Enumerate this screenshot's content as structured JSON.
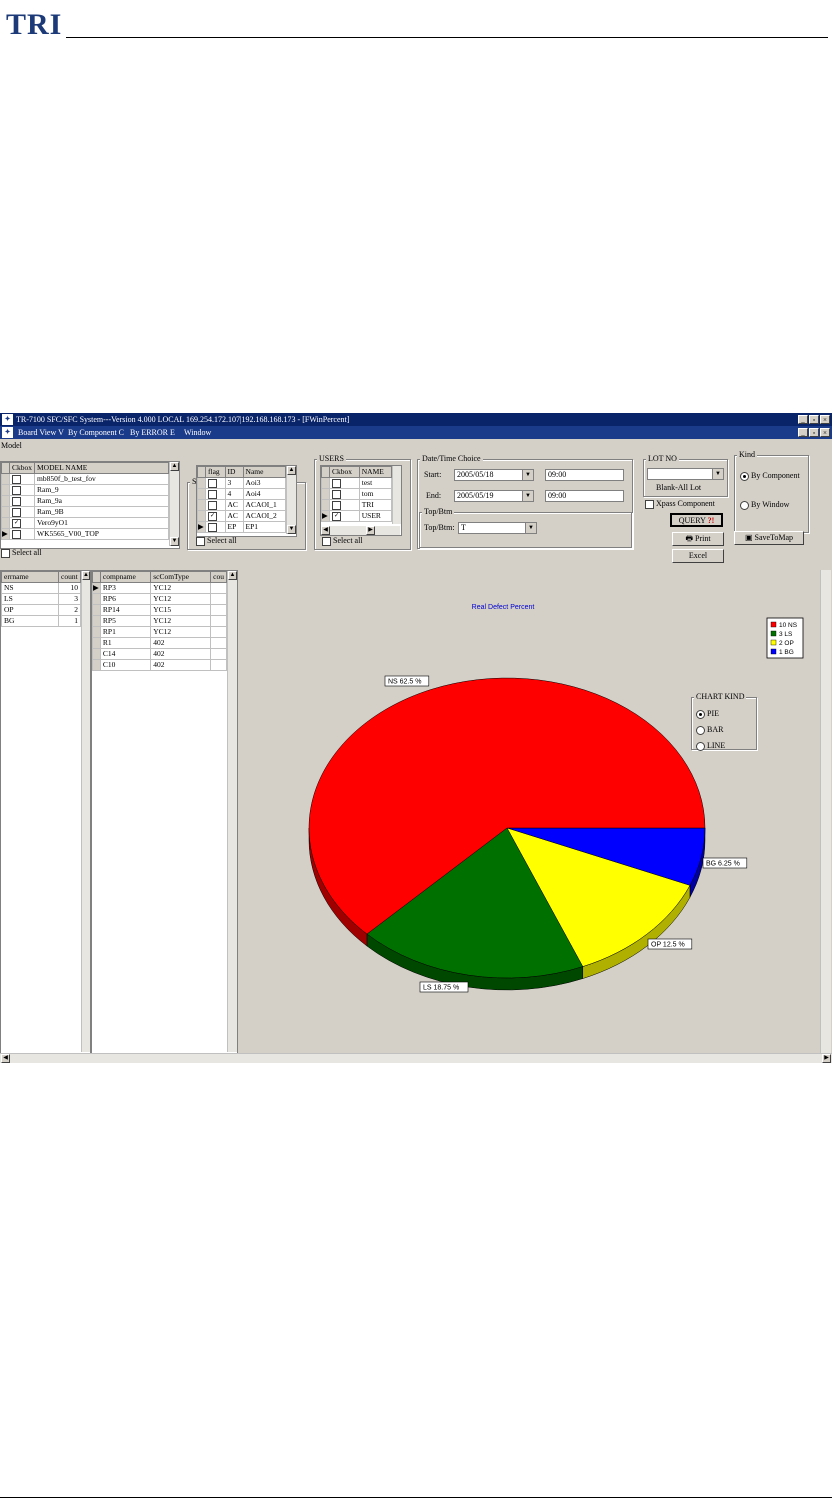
{
  "doc": {
    "logo": "TRI"
  },
  "window": {
    "title": "TR-7100 SFC/SFC System---Version 4.000 LOCAL 169.254.172.107|192.168.168.173 - [FWinPercent]",
    "menu": [
      "Board View V",
      "By Component C",
      "By ERROR E",
      "Window"
    ],
    "btn_min": "_",
    "btn_max": "▫",
    "btn_close": "×"
  },
  "model": {
    "title": "Model",
    "headers": [
      "Ckbox",
      "MODEL NAME"
    ],
    "rows": [
      {
        "name": "mb850f_b_test_fov",
        "checked": false,
        "current": false
      },
      {
        "name": "Ram_9",
        "checked": false,
        "current": false
      },
      {
        "name": "Ram_9a",
        "checked": false,
        "current": false
      },
      {
        "name": "Ram_9B",
        "checked": false,
        "current": false
      },
      {
        "name": "Vero9yO1",
        "checked": true,
        "current": false
      },
      {
        "name": "WK5565_V00_TOP",
        "checked": false,
        "current": true
      }
    ],
    "select_all": "Select all"
  },
  "status": {
    "title": "Status",
    "headers": [
      "flag",
      "ID",
      "Name"
    ],
    "rows": [
      {
        "id": "3",
        "name": "Aoi3",
        "checked": false,
        "current": false
      },
      {
        "id": "4",
        "name": "Aoi4",
        "checked": false,
        "current": false
      },
      {
        "id": "AC",
        "name": "ACAOI_1",
        "checked": false,
        "current": false
      },
      {
        "id": "AC",
        "name": "ACAOI_2",
        "checked": true,
        "current": false
      },
      {
        "id": "EP",
        "name": "EP1",
        "checked": false,
        "current": true
      }
    ],
    "select_all": "Select all"
  },
  "users": {
    "title": "USERS",
    "headers": [
      "Ckbox",
      "NAME"
    ],
    "rows": [
      {
        "name": "test",
        "checked": false,
        "current": false
      },
      {
        "name": "tom",
        "checked": false,
        "current": false
      },
      {
        "name": "TRI",
        "checked": false,
        "current": false
      },
      {
        "name": "USER",
        "checked": true,
        "current": true
      }
    ],
    "select_all": "Select all"
  },
  "datetime": {
    "title": "Date/Time Choice",
    "start_label": "Start:",
    "start_date": "2005/05/18",
    "start_time": "09:00",
    "end_label": "End:",
    "end_date": "2005/05/19",
    "end_time": "09:00"
  },
  "topbtm": {
    "title": "Top/Btm",
    "label": "Top/Btm:",
    "value": "T"
  },
  "lotno": {
    "title": "LOT NO",
    "value": "",
    "blank_label": "Blank-All Lot"
  },
  "kind": {
    "title": "Kind",
    "options": [
      "By Component",
      "By Window"
    ],
    "selected": 0
  },
  "xpass": {
    "label": "Xpass Component",
    "checked": false
  },
  "buttons": {
    "query": "QUERY",
    "print": "Print",
    "excel": "Excel",
    "save_to_map": "SaveToMap"
  },
  "error_table": {
    "headers": [
      "errname",
      "count"
    ],
    "rows": [
      [
        "NS",
        "10"
      ],
      [
        "LS",
        "3"
      ],
      [
        "OP",
        "2"
      ],
      [
        "BG",
        "1"
      ]
    ]
  },
  "comp_table": {
    "headers": [
      "compname",
      "scComType",
      "cou"
    ],
    "rows": [
      [
        "RP3",
        "YC12"
      ],
      [
        "RP6",
        "YC12"
      ],
      [
        "RP14",
        "YC15"
      ],
      [
        "RP5",
        "YC12"
      ],
      [
        "RP1",
        "YC12"
      ],
      [
        "R1",
        "402"
      ],
      [
        "C14",
        "402"
      ],
      [
        "C10",
        "402"
      ]
    ]
  },
  "chart_kind": {
    "title": "CHART KIND",
    "options": [
      "PIE",
      "BAR",
      "LINE"
    ],
    "selected": 0
  },
  "chart_data": {
    "type": "pie",
    "title": "Real Defect Percent",
    "categories": [
      "NS",
      "LS",
      "OP",
      "BG"
    ],
    "values": [
      10,
      3,
      2,
      1
    ],
    "percent_labels": [
      "NS 62.5 %",
      "LS 18.75 %",
      "OP 12.5 %",
      "BG 6.25 %"
    ],
    "legend": [
      "10 NS",
      "3 LS",
      "2 OP",
      "1 BG"
    ],
    "legend_position": "top-right",
    "colors": [
      "#ff0000",
      "#007000",
      "#ffff00",
      "#0000ff"
    ],
    "side_colors": [
      "#a00000",
      "#004800",
      "#b0b000",
      "#0000a0"
    ]
  }
}
